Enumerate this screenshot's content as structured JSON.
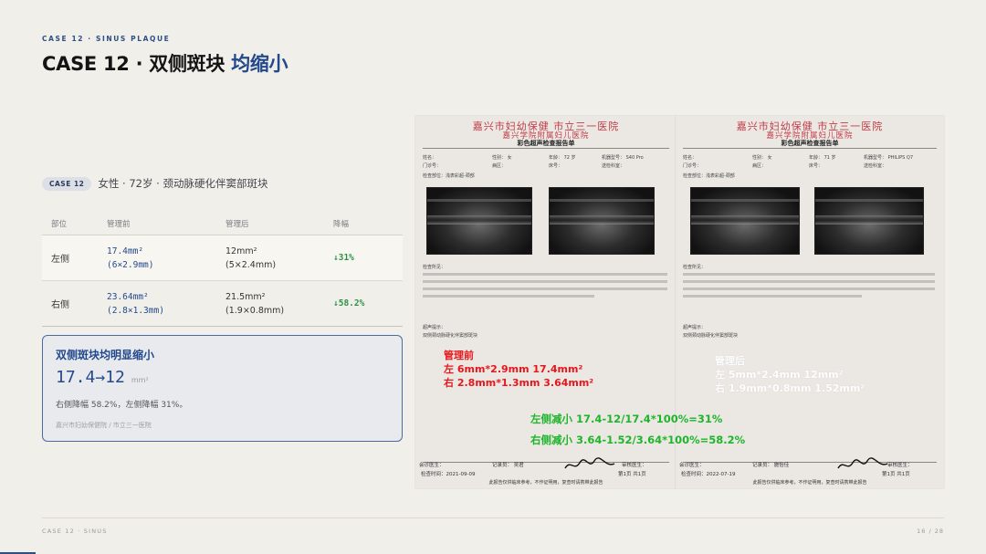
{
  "header": {
    "kicker": "CASE 12 · SINUS PLAQUE",
    "title_main": "CASE 12 · 双侧斑块",
    "title_accent": "均缩小"
  },
  "case": {
    "pill": "CASE 12",
    "description": "女性 · 72岁 · 颈动脉硬化伴窦部斑块"
  },
  "table": {
    "headers": [
      "部位",
      "管理前",
      "管理后",
      "降幅"
    ],
    "rows": [
      {
        "side": "左侧",
        "before_area": "17.4mm²",
        "before_dim": "(6×2.9mm)",
        "after_area": "12mm²",
        "after_dim": "(5×2.4mm)",
        "drop": "↓31%"
      },
      {
        "side": "右侧",
        "before_area": "23.64mm²",
        "before_dim": "(2.8×1.3mm)",
        "after_area": "21.5mm²",
        "after_dim": "(1.9×0.8mm)",
        "drop": "↓58.2%"
      }
    ]
  },
  "summary": {
    "title": "双侧斑块均明显缩小",
    "value": "17.4→12",
    "unit": "mm²",
    "text": "右侧降幅 58.2%，左侧降幅 31%。",
    "source": "嘉兴市妇幼保健院 / 市立三一医院"
  },
  "reports": {
    "hospital": "嘉兴市妇幼保健   市立三一医院",
    "subtitle": "嘉兴学院附属妇儿医院",
    "heading": "彩色超声检查报告单",
    "r1": {
      "field_name": "姓名：",
      "field_sex": "性别：  女",
      "field_age": "年龄：  72 岁",
      "field_machine": "机器型号：  S40 Pro",
      "field_dept": "门诊号：",
      "field_ward": "病区：",
      "field_bed": "床号：",
      "field_item": "送检科室：",
      "field_part": "检查部位：浅表彩超-颈部",
      "field_result": "检查所见：",
      "field_tip": "超声提示：",
      "field_conclusion": "双侧颈动脉硬化伴窦部斑块",
      "sign_left": "会诊医生：",
      "sign_mid": "记录员：  吴君",
      "sign_right": "审核医生：",
      "date": "检查时间：2021-09-09",
      "page": "第1页 共1页",
      "footer": "此报告仅供临床参考，不作证明用，复查时请携带此报告"
    },
    "r2": {
      "field_name": "姓名：",
      "field_sex": "性别：  女",
      "field_age": "年龄：  71 岁",
      "field_machine": "机器型号：  PHILIPS Q7",
      "field_dept": "门诊号：",
      "field_ward": "病区：",
      "field_bed": "床号：",
      "field_item": "送检科室：",
      "field_part": "检查部位：浅表彩超-颈部",
      "field_result": "检查所见：",
      "field_tip": "超声提示：",
      "field_conclusion": "双侧颈动脉硬化伴窦部斑块",
      "sign_left": "会诊医生：",
      "sign_mid": "记录员：  施怡佳",
      "sign_right": "审核医生：",
      "date": "检查时间：2022-07-19",
      "page": "第1页 共1页",
      "footer": "此报告仅供临床参考，不作证明用，复查时请携带此报告"
    },
    "annotations": {
      "before_title": "管理前",
      "before_left": "左 6mm*2.9mm  17.4mm²",
      "before_right": "右 2.8mm*1.3mm  3.64mm²",
      "after_title": "管理后",
      "after_left": "左 5mm*2.4mm  12mm²",
      "after_right": "右 1.9mm*0.8mm  1.52mm²",
      "calc_left": "左侧减小  17.4-12/17.4*100%=31%",
      "calc_right": "右侧减小  3.64-1.52/3.64*100%=58.2%"
    }
  },
  "footer": {
    "left": "CASE 12 · SINUS",
    "right": "16 / 28"
  },
  "colors": {
    "accent": "#23498c",
    "annotation_red": "#e8161b",
    "annotation_green": "#1fb52b",
    "drop_green": "#2f9147"
  }
}
